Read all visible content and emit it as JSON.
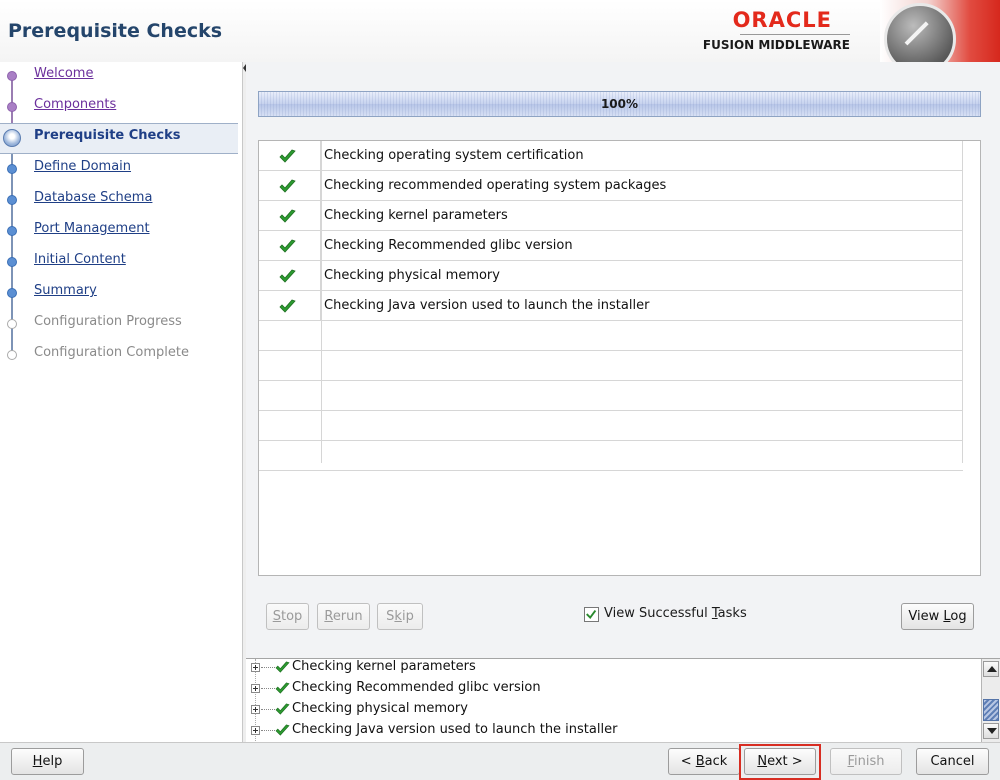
{
  "header": {
    "title": "Prerequisite Checks",
    "brand_name": "ORACLE",
    "brand_sub": "FUSION MIDDLEWARE",
    "colors": {
      "brand_red": "#e3291b",
      "title_blue": "#24456b"
    }
  },
  "sidebar": {
    "items": [
      {
        "label": "Welcome",
        "state": "visited"
      },
      {
        "label": "Components",
        "state": "visited"
      },
      {
        "label": "Prerequisite Checks",
        "state": "current"
      },
      {
        "label": "Define Domain",
        "state": "todo"
      },
      {
        "label": "Database Schema",
        "state": "todo"
      },
      {
        "label": "Port Management",
        "state": "todo"
      },
      {
        "label": "Initial Content",
        "state": "todo"
      },
      {
        "label": "Summary",
        "state": "todo"
      },
      {
        "label": "Configuration Progress",
        "state": "disabled"
      },
      {
        "label": "Configuration Complete",
        "state": "disabled"
      }
    ]
  },
  "progress": {
    "text": "100%",
    "value": 100
  },
  "tasks": [
    {
      "status": "success",
      "label": "Checking operating system certification"
    },
    {
      "status": "success",
      "label": "Checking recommended operating system packages"
    },
    {
      "status": "success",
      "label": "Checking kernel parameters"
    },
    {
      "status": "success",
      "label": "Checking Recommended glibc version"
    },
    {
      "status": "success",
      "label": "Checking physical memory"
    },
    {
      "status": "success",
      "label": "Checking Java version used to launch the installer"
    }
  ],
  "controls": {
    "stop": {
      "pre": "",
      "key": "S",
      "post": "top"
    },
    "rerun": {
      "pre": "",
      "key": "R",
      "post": "erun"
    },
    "skip": {
      "pre": "S",
      "key": "k",
      "post": "ip"
    },
    "view_successful": {
      "pre": "View Successful ",
      "key": "T",
      "post": "asks",
      "checked": true
    },
    "view_log": {
      "pre": "View ",
      "key": "L",
      "post": "og"
    }
  },
  "log": {
    "lines": [
      "Checking kernel parameters",
      "Checking Recommended glibc version",
      "Checking physical memory",
      "Checking Java version used to launch the installer"
    ]
  },
  "footer": {
    "help": {
      "pre": "",
      "key": "H",
      "post": "elp"
    },
    "back": {
      "pre": "< ",
      "key": "B",
      "post": "ack"
    },
    "next": {
      "pre": "",
      "key": "N",
      "post": "ext >"
    },
    "finish": {
      "pre": "",
      "key": "F",
      "post": "inish"
    },
    "cancel": {
      "label": "Cancel"
    }
  }
}
